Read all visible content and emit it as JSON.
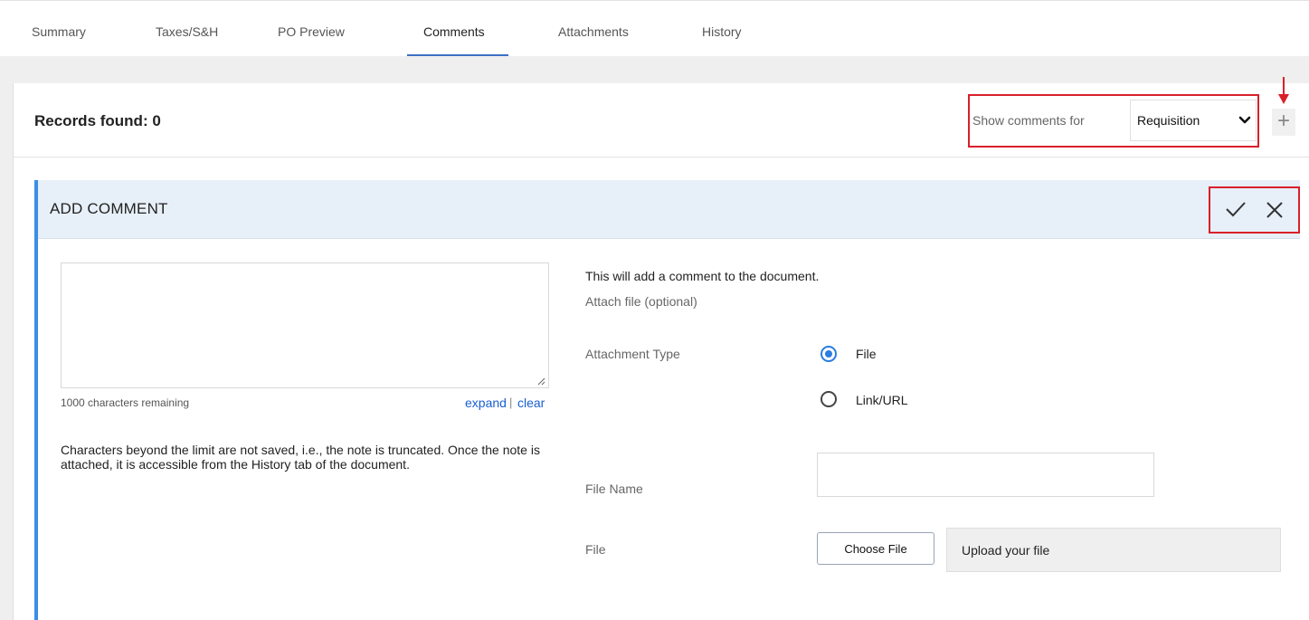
{
  "tabs": [
    {
      "label": "Summary"
    },
    {
      "label": "Taxes/S&H"
    },
    {
      "label": "PO Preview"
    },
    {
      "label": "Comments"
    },
    {
      "label": "Attachments"
    },
    {
      "label": "History"
    }
  ],
  "active_tab": "Comments",
  "records": {
    "label": "Records found: 0"
  },
  "filter": {
    "label": "Show comments for",
    "selected": "Requisition"
  },
  "add_button": {
    "icon": "plus-icon"
  },
  "card": {
    "title": "ADD COMMENT",
    "confirm_icon": "checkmark-icon",
    "close_icon": "close-icon"
  },
  "comment": {
    "value": "",
    "chars_remaining": "1000 characters remaining",
    "expand": "expand",
    "separator": "|",
    "clear": "clear",
    "note": "Characters beyond the limit are not saved, i.e., the note is truncated. Once the note is attached, it is accessible from the History tab of the document."
  },
  "attachment": {
    "info": "This will add a comment to the document.",
    "optional": "Attach file (optional)",
    "type_label": "Attachment Type",
    "options": [
      {
        "label": "File",
        "selected": true
      },
      {
        "label": "Link/URL",
        "selected": false
      }
    ],
    "file_name_label": "File Name",
    "file_name_value": "",
    "file_label": "File",
    "choose_button": "Choose File",
    "upload_placeholder": "Upload your file"
  },
  "colors": {
    "accent": "#3a8ee6",
    "tab_underline": "#3b6fc4",
    "link": "#1a5fd1",
    "highlight": "#d9202a",
    "header_bg": "#e7eff8"
  }
}
